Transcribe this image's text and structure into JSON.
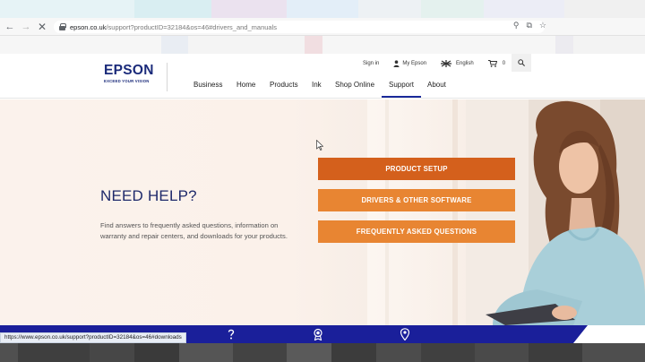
{
  "browser": {
    "url_host": "epson.co.uk",
    "url_rest": "/support?productID=32184&os=46#drivers_and_manuals",
    "status_url": "https://www.epson.co.uk/support?productID=32184&os=46#downloads"
  },
  "colors": {
    "brand_blue": "#1a2a7a",
    "cta_primary": "#d4601c",
    "cta_secondary": "#e88532",
    "band_blue": "#1a1f9a"
  },
  "header": {
    "logo_word": "EPSON",
    "logo_tag": "EXCEED YOUR VISION",
    "util": {
      "signin": "Sign in",
      "myepson": "My Epson",
      "language": "English",
      "cart_count": "0"
    },
    "nav": [
      "Business",
      "Home",
      "Products",
      "Ink",
      "Shop Online",
      "Support",
      "About"
    ],
    "active_nav": "Support"
  },
  "hero": {
    "title": "NEED HELP?",
    "body": "Find answers to frequently asked questions, information on warranty and repair centers, and downloads for your products.",
    "buttons": {
      "product_setup": "PRODUCT SETUP",
      "drivers": "DRIVERS & OTHER SOFTWARE",
      "faq": "FREQUENTLY ASKED QUESTIONS"
    }
  },
  "bottom_band": {
    "icons": [
      "question-icon",
      "award-icon",
      "location-pin-icon"
    ]
  }
}
